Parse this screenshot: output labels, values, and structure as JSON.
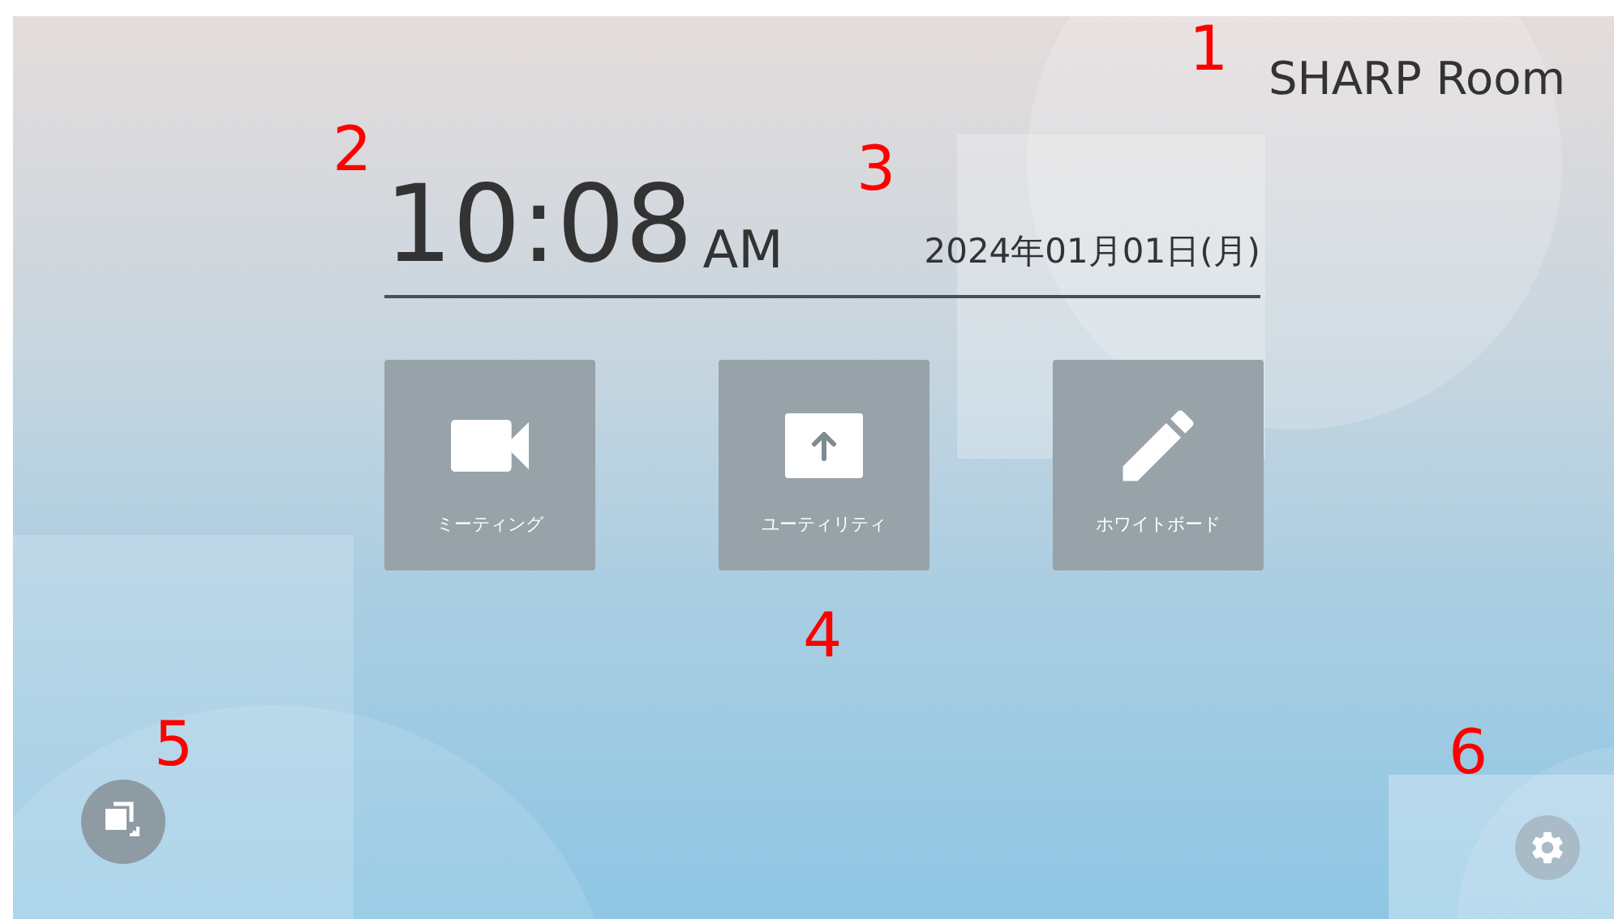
{
  "room_name": "SHARP Room",
  "clock": {
    "time": "10:08",
    "period": "AM"
  },
  "date": "2024年01月01日(月)",
  "apps": [
    {
      "kind": "video",
      "label": "ミーティング"
    },
    {
      "kind": "upload",
      "label": "ユーティリティ"
    },
    {
      "kind": "pen",
      "label": "ホワイトボード"
    }
  ],
  "annotations": [
    "1",
    "2",
    "3",
    "4",
    "5",
    "6"
  ]
}
